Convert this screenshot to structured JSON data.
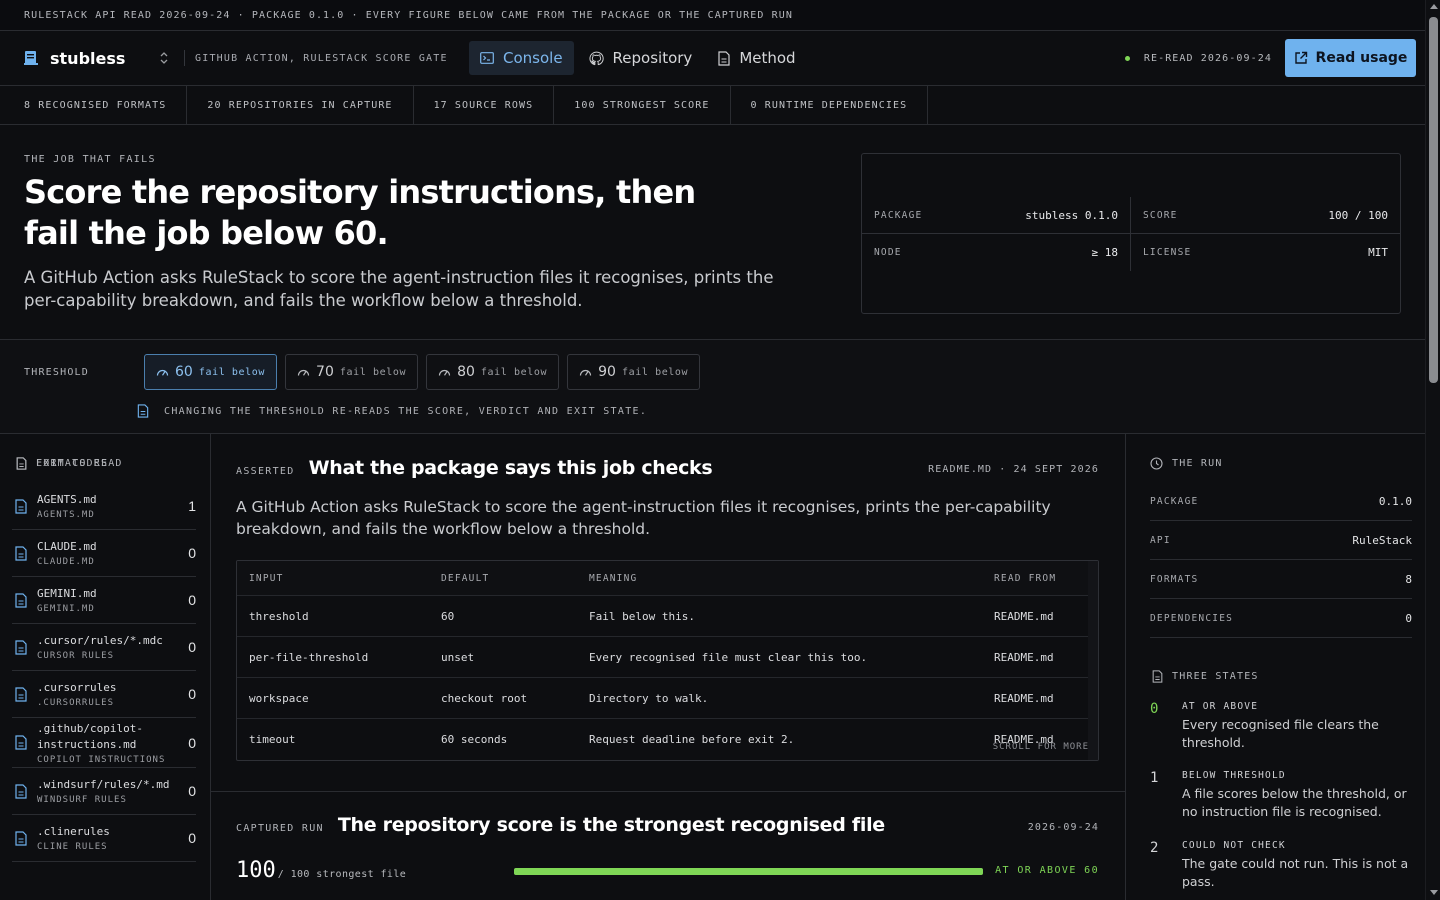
{
  "topbar": {
    "text": "RULESTACK API READ 2026-09-24 · PACKAGE 0.1.0 · EVERY FIGURE BELOW CAME FROM THE PACKAGE OR THE CAPTURED RUN"
  },
  "header": {
    "brand": "stubless",
    "tagline": "GITHUB ACTION, RULESTACK SCORE GATE",
    "nav": [
      {
        "label": "Console",
        "icon": "terminal-icon",
        "active": true
      },
      {
        "label": "Repository",
        "icon": "github-icon",
        "active": false
      },
      {
        "label": "Method",
        "icon": "document-icon",
        "active": false
      }
    ],
    "reread": "RE-READ 2026-09-24",
    "cta": "Read usage",
    "status_color": "#7fd656",
    "accent": "#6fb2ee"
  },
  "stats": [
    "8 RECOGNISED FORMATS",
    "20 REPOSITORIES IN CAPTURE",
    "17 SOURCE ROWS",
    "100 STRONGEST SCORE",
    "0 RUNTIME DEPENDENCIES"
  ],
  "hero": {
    "eyebrow": "THE JOB THAT FAILS",
    "title": "Score the repository instructions, then fail the job below 60.",
    "lede": "A GitHub Action asks RuleStack to score the agent-instruction files it recognises, prints the per-capability breakdown, and fails the workflow below a threshold.",
    "card": {
      "package_k": "PACKAGE",
      "package_v": "stubless 0.1.0",
      "score_k": "SCORE",
      "score_v": "100 / 100",
      "node_k": "NODE",
      "node_v": "≥ 18",
      "license_k": "LICENSE",
      "license_v": "MIT"
    }
  },
  "threshold": {
    "label": "THRESHOLD",
    "suffix": "fail below",
    "options": [
      "60",
      "70",
      "80",
      "90"
    ],
    "selected": "60",
    "note": "CHANGING THE THRESHOLD RE-READS THE SCORE, VERDICT AND EXIT STATE."
  },
  "formats": {
    "heading": "FORMATS READ",
    "items": [
      {
        "name": "AGENTS.md",
        "sub": "AGENTS.MD",
        "count": "1"
      },
      {
        "name": "CLAUDE.md",
        "sub": "CLAUDE.MD",
        "count": "0"
      },
      {
        "name": "GEMINI.md",
        "sub": "GEMINI.MD",
        "count": "0"
      },
      {
        "name": ".cursor/rules/*.mdc",
        "sub": "CURSOR RULES",
        "count": "0"
      },
      {
        "name": ".cursorrules",
        "sub": ".CURSORRULES",
        "count": "0"
      },
      {
        "name": ".github/copilot-instructions.md",
        "name1": ".github/copilot-",
        "name2": "instructions.md",
        "sub": "COPILOT INSTRUCTIONS",
        "count": "0"
      },
      {
        "name": ".windsurf/rules/*.md",
        "sub": "WINDSURF RULES",
        "count": "0"
      },
      {
        "name": ".clinerules",
        "sub": "CLINE RULES",
        "count": "0"
      }
    ],
    "next_heading": "EXIT CODES"
  },
  "asserted": {
    "eyebrow": "ASSERTED",
    "title": "What the package says this job checks",
    "meta": "README.MD · 24 SEPT 2026",
    "lede": "A GitHub Action asks RuleStack to score the agent-instruction files it recognises, prints the per-capability breakdown, and fails the workflow below a threshold.",
    "columns": [
      "INPUT",
      "DEFAULT",
      "MEANING",
      "READ FROM"
    ],
    "rows": [
      [
        "threshold",
        "60",
        "Fail below this.",
        "README.md"
      ],
      [
        "per-file-threshold",
        "unset",
        "Every recognised file must clear this too.",
        "README.md"
      ],
      [
        "workspace",
        "checkout root",
        "Directory to walk.",
        "README.md"
      ],
      [
        "timeout",
        "60 seconds",
        "Request deadline before exit 2.",
        "README.md"
      ]
    ],
    "scroll_hint": "SCROLL FOR MORE"
  },
  "run": {
    "eyebrow": "CAPTURED RUN",
    "title": "The repository score is the strongest recognised file",
    "date": "2026-09-24",
    "score": "100",
    "score_sub": "/ 100 strongest file",
    "score_fraction": 1.0,
    "verdict": "AT OR ABOVE 60"
  },
  "the_run": {
    "heading": "THE RUN",
    "rows": [
      {
        "k": "PACKAGE",
        "v": "0.1.0"
      },
      {
        "k": "API",
        "v": "RuleStack"
      },
      {
        "k": "FORMATS",
        "v": "8"
      },
      {
        "k": "DEPENDENCIES",
        "v": "0"
      }
    ]
  },
  "states": {
    "heading": "THREE STATES",
    "items": [
      {
        "code": "0",
        "label": "AT OR ABOVE",
        "desc": "Every recognised file clears the threshold."
      },
      {
        "code": "1",
        "label": "BELOW THRESHOLD",
        "desc": "A file scores below the threshold, or no instruction file is recognised."
      },
      {
        "code": "2",
        "label": "COULD NOT CHECK",
        "desc": "The gate could not run. This is not a pass."
      }
    ]
  }
}
